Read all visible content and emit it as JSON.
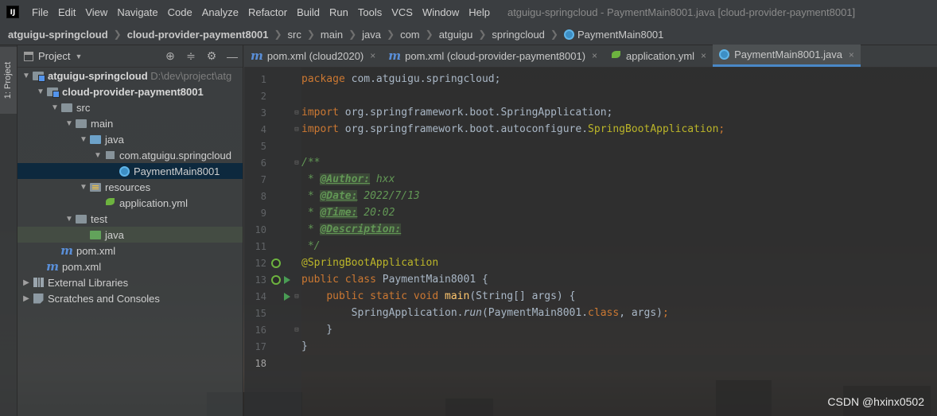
{
  "menubar": {
    "logo": "IJ",
    "items": [
      "File",
      "Edit",
      "View",
      "Navigate",
      "Code",
      "Analyze",
      "Refactor",
      "Build",
      "Run",
      "Tools",
      "VCS",
      "Window",
      "Help"
    ],
    "window_title": "atguigu-springcloud - PaymentMain8001.java [cloud-provider-payment8001]"
  },
  "breadcrumbs": [
    "atguigu-springcloud",
    "cloud-provider-payment8001",
    "src",
    "main",
    "java",
    "com",
    "atguigu",
    "springcloud",
    "PaymentMain8001"
  ],
  "toolstrip": {
    "project_tab": "1: Project"
  },
  "project_panel": {
    "title": "Project",
    "tree": [
      {
        "label": "atguigu-springcloud",
        "hint": "D:\\dev\\project\\atg"
      },
      {
        "label": "cloud-provider-payment8001"
      },
      {
        "label": "src"
      },
      {
        "label": "main"
      },
      {
        "label": "java"
      },
      {
        "label": "com.atguigu.springcloud"
      },
      {
        "label": "PaymentMain8001"
      },
      {
        "label": "resources"
      },
      {
        "label": "application.yml"
      },
      {
        "label": "test"
      },
      {
        "label": "java"
      },
      {
        "label": "pom.xml"
      },
      {
        "label": "pom.xml"
      },
      {
        "label": "External Libraries"
      },
      {
        "label": "Scratches and Consoles"
      }
    ]
  },
  "editor": {
    "tabs": [
      {
        "label": "pom.xml (cloud2020)",
        "icon": "maven-icon"
      },
      {
        "label": "pom.xml (cloud-provider-payment8001)",
        "icon": "maven-icon"
      },
      {
        "label": "application.yml",
        "icon": "spring-yaml-icon"
      },
      {
        "label": "PaymentMain8001.java",
        "icon": "java-class-icon",
        "active": true
      }
    ],
    "current_line": 18,
    "lines": [
      {
        "n": "1"
      },
      {
        "n": "2"
      },
      {
        "n": "3"
      },
      {
        "n": "4"
      },
      {
        "n": "5"
      },
      {
        "n": "6"
      },
      {
        "n": "7"
      },
      {
        "n": "8"
      },
      {
        "n": "9"
      },
      {
        "n": "10"
      },
      {
        "n": "11"
      },
      {
        "n": "12"
      },
      {
        "n": "13"
      },
      {
        "n": "14"
      },
      {
        "n": "15"
      },
      {
        "n": "16"
      },
      {
        "n": "17"
      },
      {
        "n": "18"
      }
    ],
    "code": {
      "l1_kw": "package",
      "l1_rest": " com.atguigu.springcloud;",
      "l3_kw": "import",
      "l3_rest": " org.springframework.boot.SpringApplication;",
      "l4_kw": "import",
      "l4_rest": " org.springframework.boot.autoconfigure.",
      "l4_ann": "SpringBootApplication",
      "l4_end": ";",
      "l6": "/**",
      "l7_star": " * ",
      "l7_tag": "@Author:",
      "l7_val": " hxx",
      "l8_star": " * ",
      "l8_tag": "@Date:",
      "l8_val": " 2022/7/13",
      "l9_star": " * ",
      "l9_tag": "@Time:",
      "l9_val": " 20:02",
      "l10_star": " * ",
      "l10_tag": "@Description:",
      "l11": " */",
      "l12": "@SpringBootApplication",
      "l13_kw": "public class",
      "l13_rest": " PaymentMain8001 {",
      "l14_indent": "    ",
      "l14_kw": "public static void",
      "l14_sp": " ",
      "l14_fn": "main",
      "l14_rest": "(String[] args) {",
      "l15_a": "        SpringApplication.",
      "l15_run": "run",
      "l15_b": "(PaymentMain8001.",
      "l15_kw": "class",
      "l15_c": ", args)",
      "l15_semi": ";",
      "l16": "    }",
      "l17": "}"
    }
  },
  "watermark": "CSDN @hxinx0502"
}
